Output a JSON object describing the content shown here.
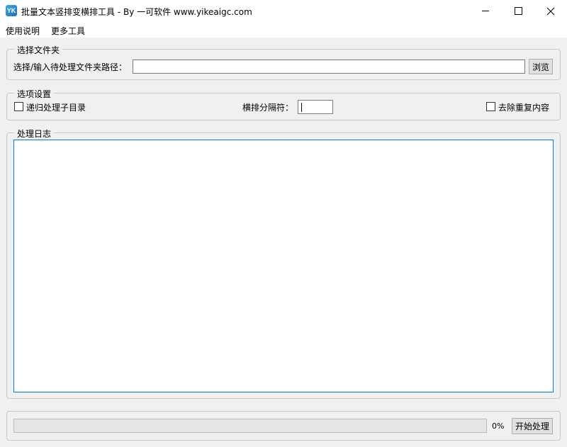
{
  "window": {
    "title": "批量文本竖排变横排工具 - By 一可软件 www.yikeaigc.com",
    "icon": "yk-app-icon",
    "icon_letter": "YK"
  },
  "menu": {
    "items": [
      "使用说明",
      "更多工具"
    ]
  },
  "folder_group": {
    "legend": "选择文件夹",
    "path_label": "选择/输入待处理文件夹路径：",
    "path_value": "",
    "browse_label": "浏览"
  },
  "options_group": {
    "legend": "选项设置",
    "recursive_label": "递归处理子目录",
    "recursive_checked": false,
    "separator_label": "横排分隔符：",
    "separator_value": "",
    "dedupe_label": "去除重复内容",
    "dedupe_checked": false
  },
  "log_group": {
    "legend": "处理日志",
    "log_text": ""
  },
  "footer": {
    "progress_percent": 0,
    "progress_text": "0%",
    "start_label": "开始处理"
  },
  "colors": {
    "accent": "#0078d7",
    "window_bg": "#f0f0f0"
  }
}
